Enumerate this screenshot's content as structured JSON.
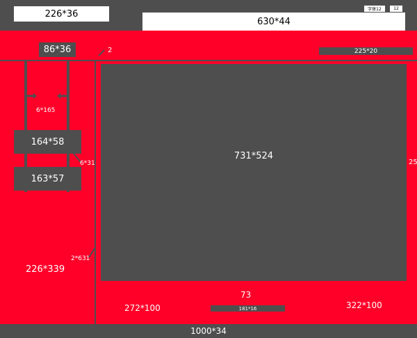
{
  "header": {
    "logo_box": "226*36",
    "search_box": "630*44",
    "chip_left": "字体12",
    "chip_right": "12"
  },
  "body": {
    "nav_button": "86*36",
    "divider_label": "2",
    "top_right_bar": "225*20",
    "left_panel_label": "226*339",
    "arrow_label": "6*165",
    "box_upper": "164*58",
    "box_lower": "163*57",
    "connector_label": "6*31",
    "long_line_label": "2*631",
    "main_area": "731*524",
    "right_edge_label": "25",
    "gap_label": "73",
    "bottom_left_label": "272*100",
    "bottom_mid_bar": "181*16",
    "bottom_right_label": "322*100"
  },
  "footer": {
    "label": "1000*34"
  },
  "colors": {
    "red": "#ff0029",
    "dark": "#4e4e4e",
    "white": "#ffffff"
  }
}
